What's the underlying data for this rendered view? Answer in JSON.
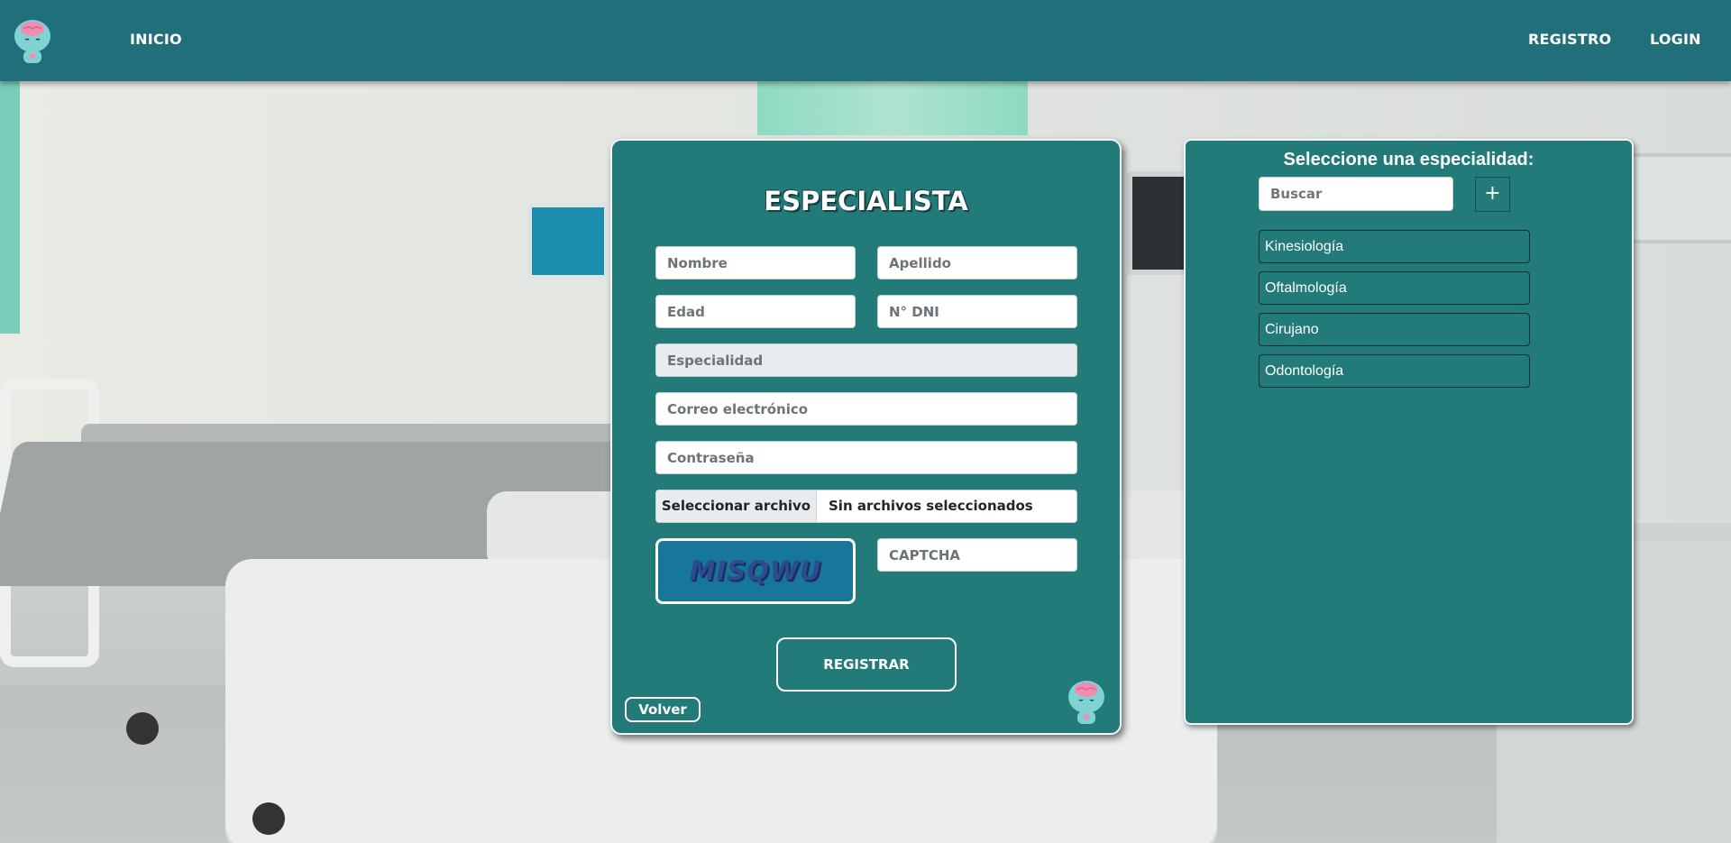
{
  "header": {
    "nav_inicio": "INICIO",
    "nav_registro": "REGISTRO",
    "nav_login": "LOGIN",
    "logo_icon": "mascot-logo-icon"
  },
  "form": {
    "title": "ESPECIALISTA",
    "nombre_placeholder": "Nombre",
    "apellido_placeholder": "Apellido",
    "edad_placeholder": "Edad",
    "dni_placeholder": "N° DNI",
    "especialidad_placeholder": "Especialidad",
    "correo_placeholder": "Correo electrónico",
    "contrasena_placeholder": "Contraseña",
    "file_button": "Seleccionar archivo",
    "file_status": "Sin archivos seleccionados",
    "captcha_text": "MISQWU",
    "captcha_placeholder": "CAPTCHA",
    "submit_label": "REGISTRAR",
    "back_label": "Volver"
  },
  "specialties": {
    "title": "Seleccione una especialidad:",
    "search_placeholder": "Buscar",
    "add_label": "+",
    "items": [
      "Kinesiología",
      "Oftalmología",
      "Cirujano",
      "Odontología"
    ]
  },
  "colors": {
    "header_bg": "#226f7c",
    "card_bg": "#227a79",
    "captcha_bg": "#17779a",
    "mascot_body": "#7fd3d3",
    "mascot_brain": "#f28db2"
  }
}
